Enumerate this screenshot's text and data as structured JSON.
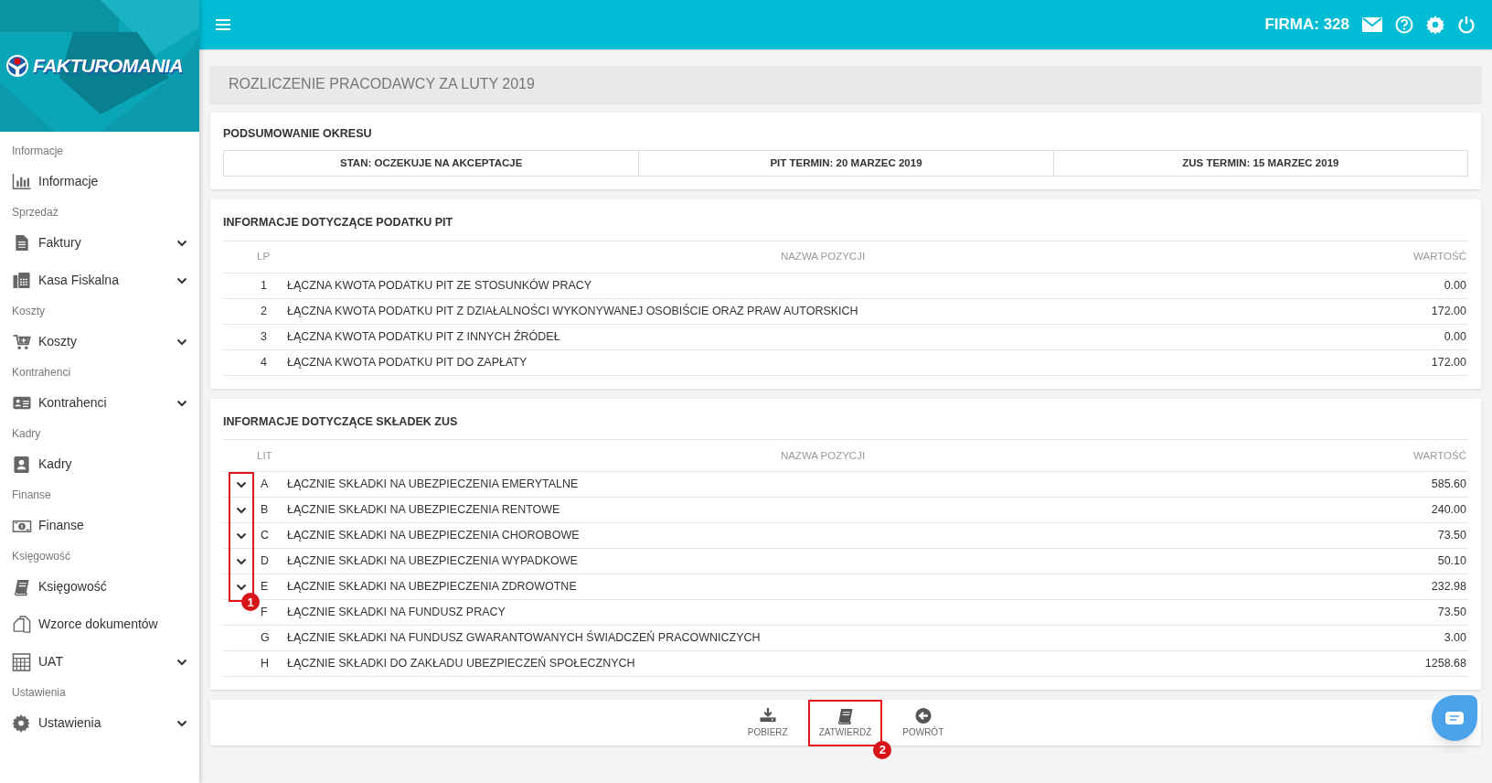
{
  "logo": {
    "text": "FAKTUROMANIA"
  },
  "topbar": {
    "company": "FIRMA: 328"
  },
  "sidebar": {
    "sections": [
      {
        "label": "Informacje",
        "items": [
          {
            "label": "Informacje",
            "kind": "chart",
            "expandable": false
          }
        ]
      },
      {
        "label": "Sprzedaż",
        "items": [
          {
            "label": "Faktury",
            "kind": "document",
            "expandable": true
          },
          {
            "label": "Kasa Fiskalna",
            "kind": "register",
            "expandable": true
          }
        ]
      },
      {
        "label": "Koszty",
        "items": [
          {
            "label": "Koszty",
            "kind": "cart",
            "expandable": true
          }
        ]
      },
      {
        "label": "Kontrahenci",
        "items": [
          {
            "label": "Kontrahenci",
            "kind": "card",
            "expandable": true
          }
        ]
      },
      {
        "label": "Kadry",
        "items": [
          {
            "label": "Kadry",
            "kind": "contact",
            "expandable": false
          }
        ]
      },
      {
        "label": "Finanse",
        "items": [
          {
            "label": "Finanse",
            "kind": "money",
            "expandable": false
          }
        ]
      },
      {
        "label": "Księgowość",
        "items": [
          {
            "label": "Księgowość",
            "kind": "book",
            "expandable": false
          },
          {
            "label": "Wzorce dokumentów",
            "kind": "copy",
            "expandable": false
          },
          {
            "label": "UAT",
            "kind": "calculator",
            "expandable": true
          }
        ]
      },
      {
        "label": "Ustawienia",
        "items": [
          {
            "label": "Ustawienia",
            "kind": "gear",
            "expandable": true
          }
        ]
      }
    ]
  },
  "page_title": "ROZLICZENIE PRACODAWCY ZA LUTY 2019",
  "summary": {
    "title": "PODSUMOWANIE OKRESU",
    "cells": [
      "STAN: OCZEKUJE NA AKCEPTACJE",
      "PIT TERMIN: 20 MARZEC 2019",
      "ZUS TERMIN: 15 MARZEC 2019"
    ]
  },
  "pit": {
    "title": "INFORMACJE DOTYCZĄCE PODATKU PIT",
    "columns": [
      "LP",
      "NAZWA POZYCJI",
      "WARTOŚĆ"
    ],
    "rows": [
      {
        "lp": "1",
        "name": "ŁĄCZNA KWOTA PODATKU PIT ZE STOSUNKÓW PRACY",
        "value": "0.00"
      },
      {
        "lp": "2",
        "name": "ŁĄCZNA KWOTA PODATKU PIT Z DZIAŁALNOŚCI WYKONYWANEJ OSOBIŚCIE ORAZ PRAW AUTORSKICH",
        "value": "172.00"
      },
      {
        "lp": "3",
        "name": "ŁĄCZNA KWOTA PODATKU PIT Z INNYCH ŹRÓDEŁ",
        "value": "0.00"
      },
      {
        "lp": "4",
        "name": "ŁĄCZNA KWOTA PODATKU PIT DO ZAPŁATY",
        "value": "172.00"
      }
    ]
  },
  "zus": {
    "title": "INFORMACJE DOTYCZĄCE SKŁADEK ZUS",
    "columns": [
      "LIT",
      "NAZWA POZYCJI",
      "WARTOŚĆ"
    ],
    "annotation": "1",
    "rows": [
      {
        "lit": "A",
        "name": "ŁĄCZNIE SKŁADKI NA UBEZPIECZENIA EMERYTALNE",
        "value": "585.60",
        "expandable": true
      },
      {
        "lit": "B",
        "name": "ŁĄCZNIE SKŁADKI NA UBEZPIECZENIA RENTOWE",
        "value": "240.00",
        "expandable": true
      },
      {
        "lit": "C",
        "name": "ŁĄCZNIE SKŁADKI NA UBEZPIECZENIA CHOROBOWE",
        "value": "73.50",
        "expandable": true
      },
      {
        "lit": "D",
        "name": "ŁĄCZNIE SKŁADKI NA UBEZPIECZENIA WYPADKOWE",
        "value": "50.10",
        "expandable": true
      },
      {
        "lit": "E",
        "name": "ŁĄCZNIE SKŁADKI NA UBEZPIECZENIA ZDROWOTNE",
        "value": "232.98",
        "expandable": true
      },
      {
        "lit": "F",
        "name": "ŁĄCZNIE SKŁADKI NA FUNDUSZ PRACY",
        "value": "73.50",
        "expandable": false
      },
      {
        "lit": "G",
        "name": "ŁĄCZNIE SKŁADKI NA FUNDUSZ GWARANTOWANYCH ŚWIADCZEŃ PRACOWNICZYCH",
        "value": "3.00",
        "expandable": false
      },
      {
        "lit": "H",
        "name": "ŁĄCZNIE SKŁADKI DO ZAKŁADU UBEZPIECZEŃ SPOŁECZNYCH",
        "value": "1258.68",
        "expandable": false
      }
    ]
  },
  "actions": [
    {
      "label": "POBIERZ",
      "kind": "download"
    },
    {
      "label": "ZATWIERDŹ",
      "kind": "book",
      "annotation": "2"
    },
    {
      "label": "POWRÓT",
      "kind": "back"
    }
  ]
}
